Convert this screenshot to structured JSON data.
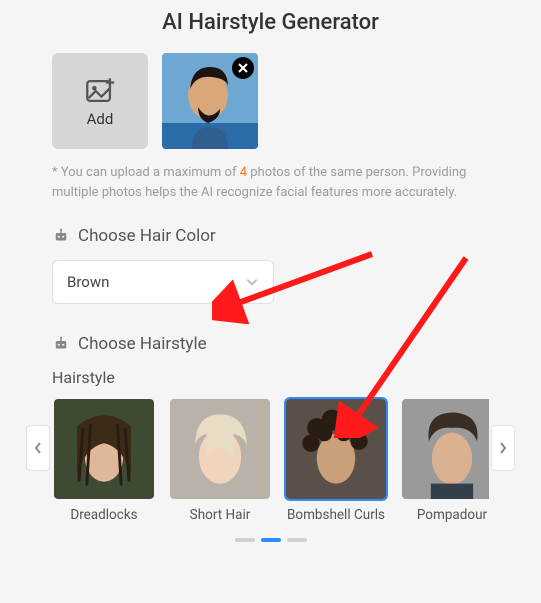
{
  "title": "AI Hairstyle Generator",
  "upload": {
    "add_label": "Add",
    "hint_prefix": "* You can upload a maximum of ",
    "hint_max": "4",
    "hint_suffix": " photos of the same person. Providing multiple photos helps the AI recognize facial features more accurately."
  },
  "color_section": {
    "heading": "Choose Hair Color",
    "selected": "Brown"
  },
  "style_section": {
    "heading": "Choose Hairstyle",
    "sub_label": "Hairstyle",
    "items": [
      {
        "label": "Dreadlocks"
      },
      {
        "label": "Short Hair"
      },
      {
        "label": "Bombshell Curls"
      },
      {
        "label": "Pompadour"
      }
    ],
    "selected_index": 2,
    "page_index": 1,
    "page_count": 3
  }
}
